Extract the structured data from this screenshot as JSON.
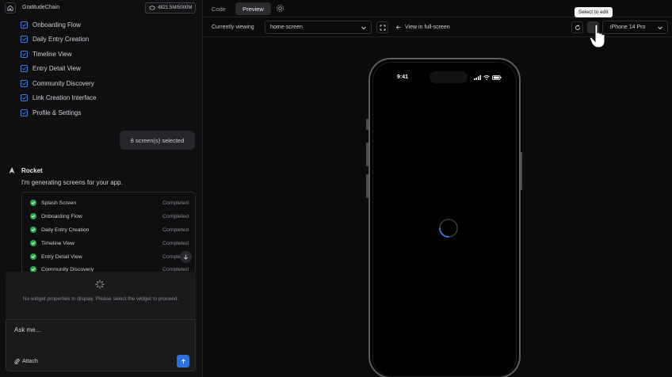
{
  "header": {
    "app_title": "GratitudeChain",
    "credits": "4821.5M/5000M"
  },
  "screens": [
    "Onboarding Flow",
    "Daily Entry Creation",
    "Timeline View",
    "Entry Detail View",
    "Community Discovery",
    "Link Creation Interface",
    "Profile & Settings"
  ],
  "chat": {
    "selected_pill": "8 screen(s) selected",
    "assistant_name": "Rocket",
    "assistant_message": "I'm generating screens for your app.",
    "progress": [
      {
        "name": "Splash Screen",
        "status": "Completed"
      },
      {
        "name": "Onboarding Flow",
        "status": "Completed"
      },
      {
        "name": "Daily Entry Creation",
        "status": "Completed"
      },
      {
        "name": "Timeline View",
        "status": "Completed"
      },
      {
        "name": "Entry Detail View",
        "status": "Completed"
      },
      {
        "name": "Community Discovery",
        "status": "Completed"
      }
    ]
  },
  "widget_panel": {
    "message": "No widget properties to display. Please select the widget to proceed."
  },
  "composer": {
    "placeholder": "Ask me...",
    "attach_label": "Attach"
  },
  "tabs": {
    "code": "Code",
    "preview": "Preview"
  },
  "toolbar": {
    "currently_viewing_label": "Currently viewing",
    "screen_select_value": "home-screen",
    "view_fullscreen_label": "View in full-screen",
    "tooltip": "Select to edit",
    "device_value": "iPhone 14 Pro"
  },
  "phone": {
    "time": "9:41"
  },
  "colors": {
    "accent": "#2f6fd6",
    "success": "#2ea44f",
    "checkbox": "#4a7bd8"
  }
}
